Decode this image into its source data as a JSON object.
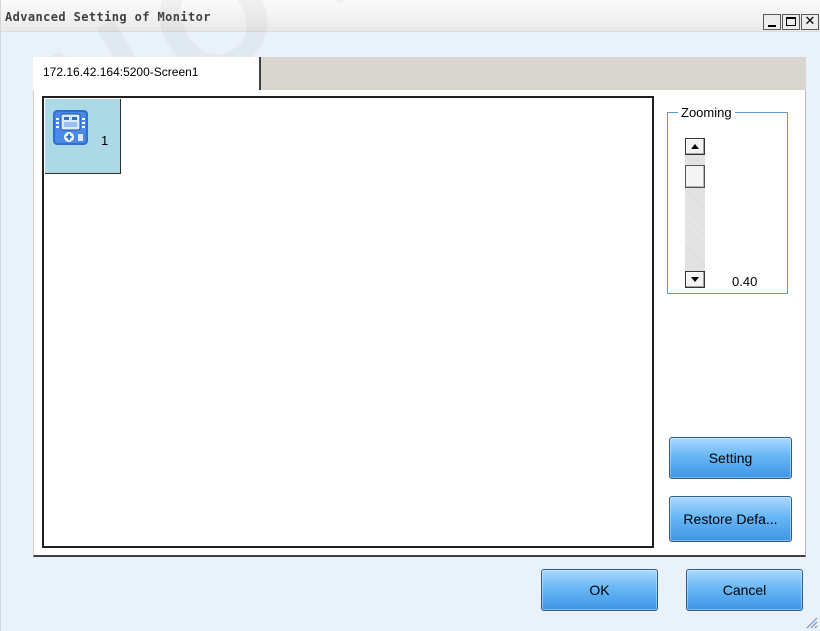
{
  "window": {
    "title": "Advanced Setting of Monitor",
    "controls": {
      "minimize": "minimize-icon",
      "maximize": "maximize-icon",
      "close_glyph": "✕"
    }
  },
  "tabs": [
    {
      "label": "172.16.42.164:5200-Screen1",
      "selected": true
    }
  ],
  "monitor_area": {
    "devices": [
      {
        "label": "1",
        "icon": "receiving-card-icon"
      }
    ]
  },
  "zooming": {
    "legend": "Zooming",
    "value": "0.40"
  },
  "buttons": {
    "setting": "Setting",
    "restore_default": "Restore Defa...",
    "ok": "OK",
    "cancel": "Cancel"
  },
  "watermark": "NOVASTAR",
  "colors": {
    "window_bg": "#e9f1fb",
    "button_blue": "#4d9fe8",
    "selected_item": "#add8e6",
    "group_border": "#5b9bd5"
  }
}
